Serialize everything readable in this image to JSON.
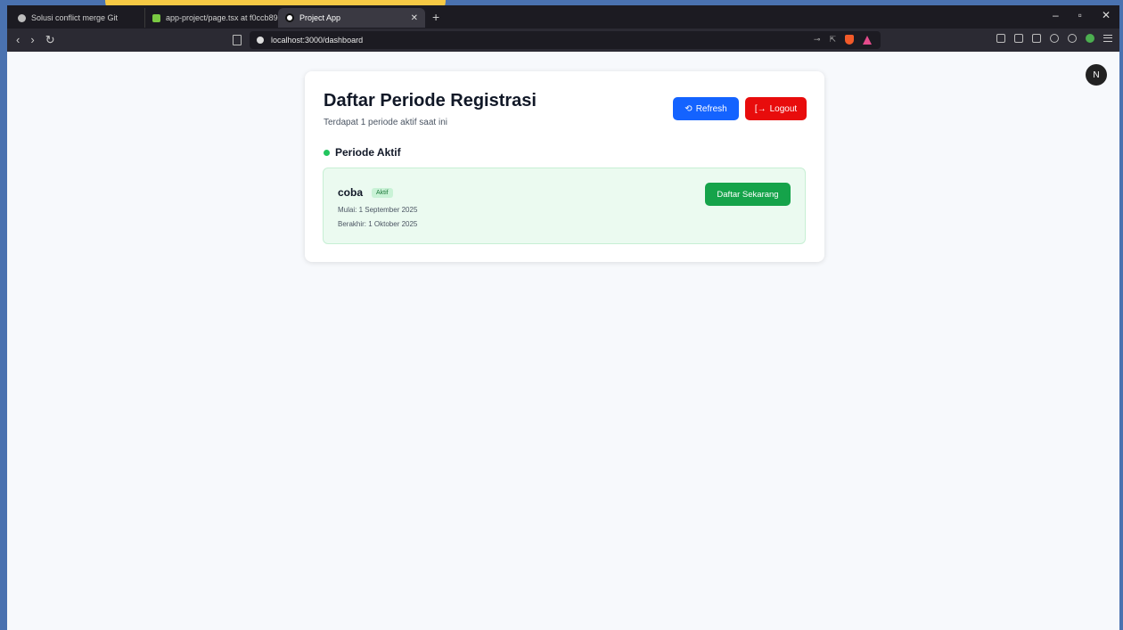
{
  "browser": {
    "tabs": [
      {
        "title": "Solusi conflict merge Git"
      },
      {
        "title": "app-project/page.tsx at f0ccb897e9..."
      },
      {
        "title": "Project App"
      }
    ],
    "url": "localhost:3000/dashboard",
    "nav": {
      "back": "‹",
      "forward": "›",
      "reload": "↻"
    },
    "window_controls": {
      "minimize": "–",
      "maximize": "▫",
      "close": "✕"
    },
    "new_tab": "+",
    "tab_close": "✕"
  },
  "user": {
    "avatar_initial": "N"
  },
  "dashboard": {
    "title": "Daftar Periode Registrasi",
    "subtitle": "Terdapat 1 periode aktif saat ini",
    "refresh_label": "Refresh",
    "refresh_icon": "⟲",
    "logout_label": "Logout",
    "logout_icon": "[→",
    "section_title": "Periode Aktif",
    "periods": [
      {
        "name": "coba",
        "status": "Aktif",
        "start": "Mulai: 1 September 2025",
        "end": "Berakhir: 1 Oktober 2025",
        "action": "Daftar Sekarang"
      }
    ]
  },
  "colors": {
    "refresh": "#1463ff",
    "logout": "#e80c0c",
    "register": "#15a34a",
    "active_dot": "#22c55e"
  }
}
